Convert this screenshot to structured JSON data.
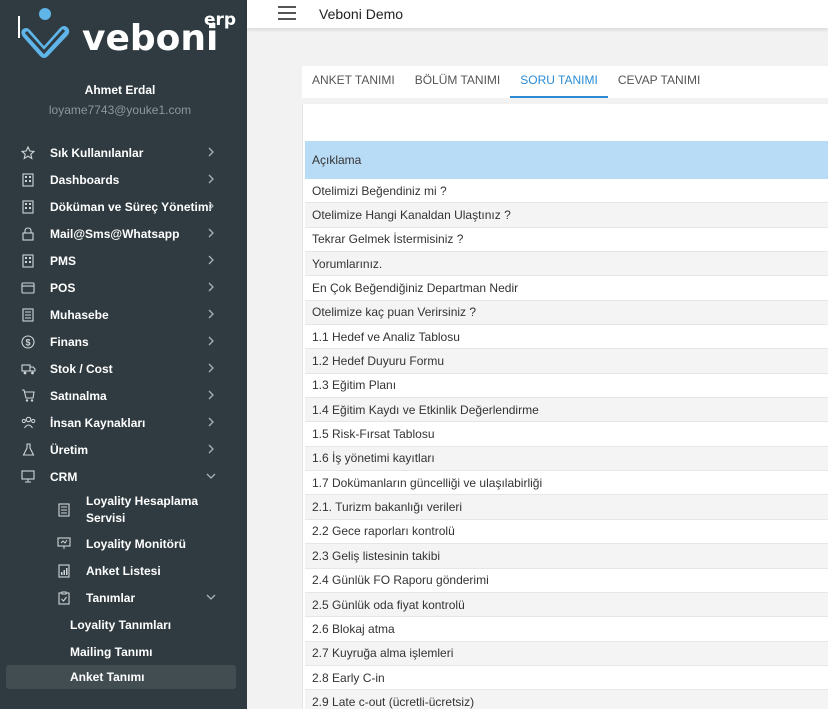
{
  "brand": {
    "name": "veboni",
    "suffix": "erp"
  },
  "user": {
    "name": "Ahmet Erdal",
    "email": "loyame7743@youke1.com"
  },
  "menu": [
    {
      "label": "Sık Kullanılanlar",
      "icon": "star-icon"
    },
    {
      "label": "Dashboards",
      "icon": "building-icon"
    },
    {
      "label": "Döküman ve Süreç Yönetimi",
      "icon": "building-icon"
    },
    {
      "label": "Mail@Sms@Whatsapp",
      "icon": "lock-icon"
    },
    {
      "label": "PMS",
      "icon": "building-icon"
    },
    {
      "label": "POS",
      "icon": "card-icon"
    },
    {
      "label": "Muhasebe",
      "icon": "document-icon"
    },
    {
      "label": "Finans",
      "icon": "dollar-icon"
    },
    {
      "label": "Stok / Cost",
      "icon": "truck-icon"
    },
    {
      "label": "Satınalma",
      "icon": "cart-icon"
    },
    {
      "label": "İnsan Kaynakları",
      "icon": "people-icon"
    },
    {
      "label": "Üretim",
      "icon": "flask-icon"
    },
    {
      "label": "CRM",
      "icon": "monitor-icon"
    }
  ],
  "crm_sub": [
    {
      "label": "Loyality Hesaplama Servisi",
      "icon": "document-icon"
    },
    {
      "label": "Loyality Monitörü",
      "icon": "presentation-icon"
    },
    {
      "label": "Anket Listesi",
      "icon": "chart-file-icon"
    },
    {
      "label": "Tanımlar",
      "icon": "clipboard-check-icon"
    }
  ],
  "tanimlar_sub": [
    {
      "label": "Loyality Tanımları"
    },
    {
      "label": "Mailing Tanımı"
    },
    {
      "label": "Anket Tanımı"
    }
  ],
  "header": {
    "title": "Veboni Demo"
  },
  "tabs": [
    {
      "label": "ANKET TANIMI"
    },
    {
      "label": "BÖLÜM TANIMI"
    },
    {
      "label": "SORU TANIMI"
    },
    {
      "label": "CEVAP TANIMI"
    }
  ],
  "active_tab": "SORU TANIMI",
  "table": {
    "column": "Açıklama",
    "rows": [
      "Otelimizi Beğendiniz mi ?",
      "Otelimize Hangi Kanaldan Ulaştınız ?",
      "Tekrar Gelmek İstermisiniz ?",
      "Yorumlarınız.",
      "En Çok Beğendiğiniz Departman Nedir",
      "Otelimize kaç puan Verirsiniz ?",
      "1.1 Hedef ve Analiz Tablosu",
      "1.2 Hedef Duyuru Formu",
      "1.3 Eğitim Planı",
      "1.4 Eğitim Kaydı ve Etkinlik Değerlendirme",
      "1.5 Risk-Fırsat Tablosu",
      "1.6 İş yönetimi kayıtları",
      "1.7 Dokümanların güncelliği ve ulaşılabirliği",
      "2.1. Turizm bakanlığı verileri",
      "2.2 Gece raporları kontrolü",
      "2.3 Geliş listesinin takibi",
      "2.4 Günlük FO Raporu gönderimi",
      "2.5 Günlük oda fiyat kontrolü",
      "2.6 Blokaj atma",
      "2.7 Kuyruğa alma işlemleri",
      "2.8 Early C-in",
      "2.9 Late c-out (ücretli-ücretsiz)"
    ]
  },
  "colors": {
    "sidebar": "#2f3b40",
    "accent": "#2c8bd4",
    "table_header": "#b9dcf6",
    "logo_mark": "#5fb5e8"
  }
}
